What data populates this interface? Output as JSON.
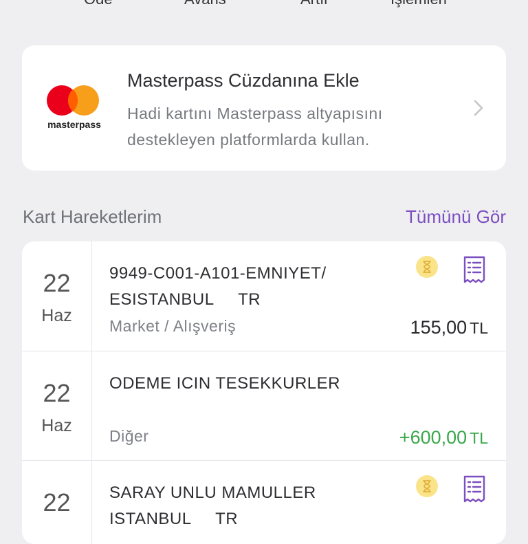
{
  "top_actions": [
    "Öde",
    "Avans",
    "Artır",
    "İşlemleri"
  ],
  "masterpass": {
    "logo_text": "masterpass",
    "title": "Masterpass Cüzdanına Ekle",
    "description": "Hadi kartını Masterpass altyapısını destekleyen platformlarda kullan."
  },
  "transactions_section": {
    "title": "Kart Hareketlerim",
    "see_all": "Tümünü Gör",
    "items": [
      {
        "day": "22",
        "month": "Haz",
        "description": "9949-C001-A101-EMNIYET/\nESISTANBUL     TR",
        "category": "Market / Alışveriş",
        "amount": "155,00",
        "currency": "TL",
        "pending_icon": "hourglass-icon",
        "receipt_icon": "receipt-icon"
      },
      {
        "day": "22",
        "month": "Haz",
        "description": "ODEME ICIN TESEKKURLER",
        "category": "Diğer",
        "amount": "+600,00",
        "currency": "TL"
      },
      {
        "day": "22",
        "month": "",
        "description": "SARAY UNLU MAMULLER\nISTANBUL     TR",
        "category": "",
        "amount": "",
        "currency": "",
        "pending_icon": "hourglass-icon",
        "receipt_icon": "receipt-icon"
      }
    ]
  },
  "colors": {
    "accent_purple": "#7c4fc0",
    "positive_green": "#3aa74a",
    "pending_yellow": "#fbe38a",
    "mastercard_red": "#eb001b",
    "mastercard_orange": "#f79e1b",
    "background": "#efeff2"
  }
}
